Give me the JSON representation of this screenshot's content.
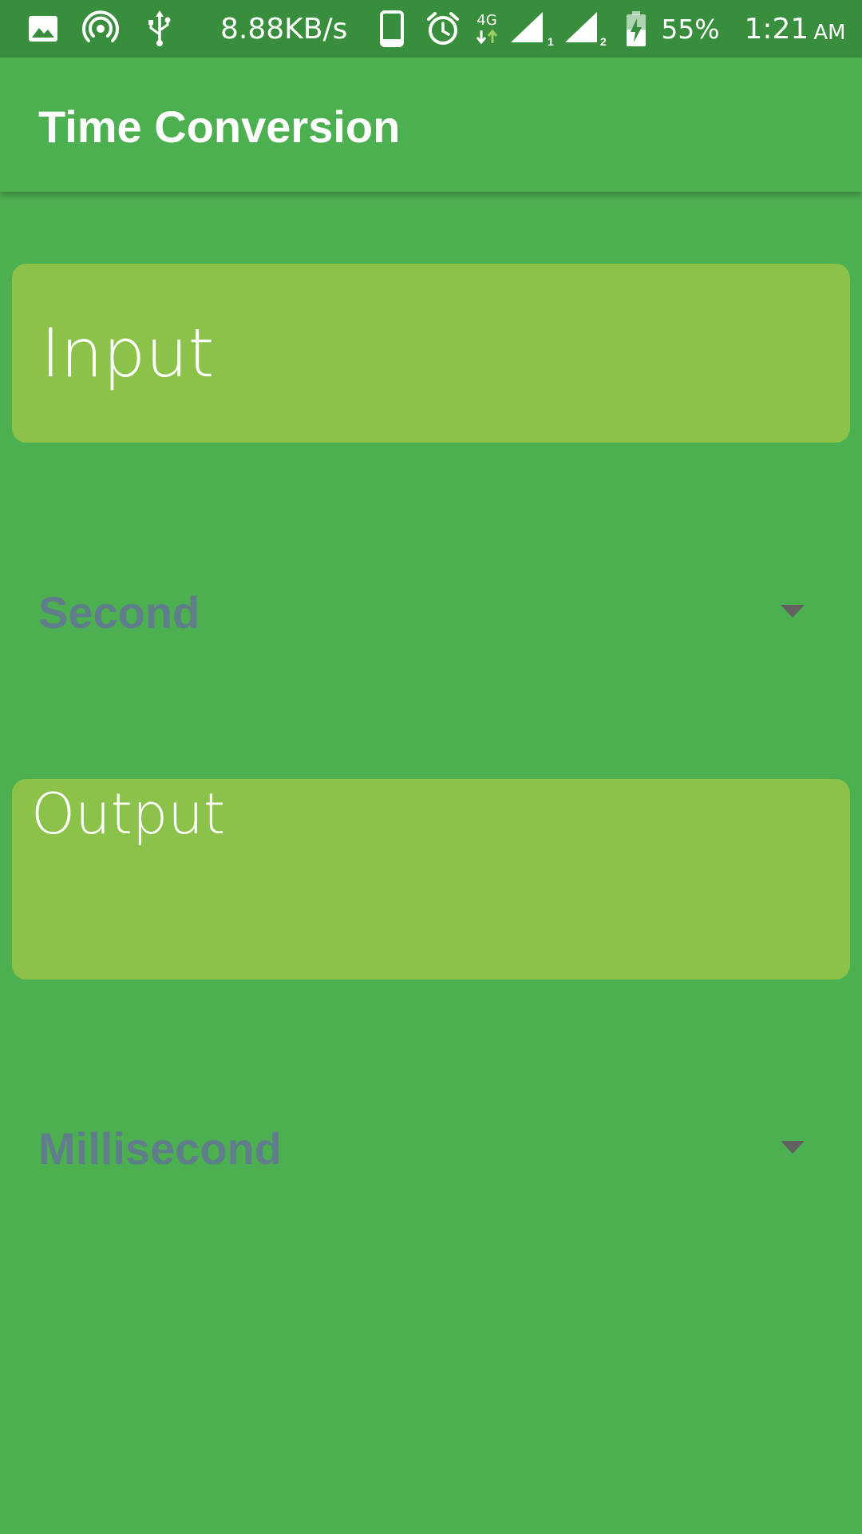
{
  "status_bar": {
    "network_speed": "8.88KB/s",
    "network_type": "4G",
    "sim1_label": "1",
    "sim2_label": "2",
    "battery_percent": "55%",
    "time": "1:21",
    "ampm": "AM",
    "icons": [
      "image-icon",
      "hotspot-icon",
      "usb-icon",
      "phone-icon",
      "alarm-icon",
      "network-4g-icon",
      "signal-sim1-icon",
      "signal-sim2-icon",
      "battery-charging-icon"
    ]
  },
  "app_bar": {
    "title": "Time Conversion"
  },
  "input": {
    "placeholder": "Input",
    "value": ""
  },
  "from_unit": {
    "selected": "Second"
  },
  "output": {
    "placeholder": "Output",
    "value": ""
  },
  "to_unit": {
    "selected": "Millisecond"
  },
  "colors": {
    "background": "#4caf50",
    "status_bar": "#388e3c",
    "field_background": "#8bc34a",
    "dropdown_text": "#607d8b",
    "dropdown_arrow": "#616161",
    "text_on_primary": "#ffffff"
  }
}
